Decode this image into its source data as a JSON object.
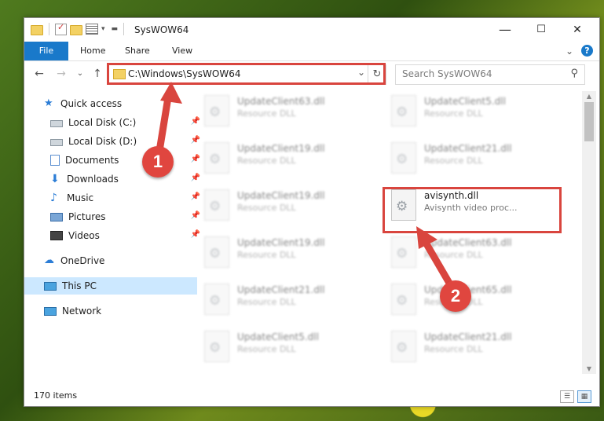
{
  "window": {
    "title": "SysWOW64",
    "controls": {
      "minimize": "—",
      "maximize": "☐",
      "close": "✕"
    }
  },
  "ribbon": {
    "tabs": [
      "File",
      "Home",
      "Share",
      "View"
    ],
    "expand_glyph": "⌄",
    "help_glyph": "?"
  },
  "address_bar": {
    "path": "C:\\Windows\\SysWOW64",
    "dropdown_glyph": "⌄",
    "refresh_glyph": "↻"
  },
  "search": {
    "placeholder": "Search SysWOW64",
    "icon_glyph": "⚲"
  },
  "nav_buttons": {
    "back": "←",
    "forward": "→",
    "recent": "⌄",
    "up": "↑"
  },
  "sidebar": {
    "items": [
      {
        "label": "Quick access",
        "icon": "star-icon"
      },
      {
        "label": "Local Disk (C:)",
        "icon": "drive-icon",
        "pinned": true
      },
      {
        "label": "Local Disk (D:)",
        "icon": "drive-icon",
        "pinned": true
      },
      {
        "label": "Documents",
        "icon": "document-icon",
        "pinned": true
      },
      {
        "label": "Downloads",
        "icon": "download-icon",
        "pinned": true
      },
      {
        "label": "Music",
        "icon": "music-icon",
        "pinned": true
      },
      {
        "label": "Pictures",
        "icon": "picture-icon",
        "pinned": true
      },
      {
        "label": "Videos",
        "icon": "video-icon",
        "pinned": true
      },
      {
        "label": "OneDrive",
        "icon": "cloud-icon"
      },
      {
        "label": "This PC",
        "icon": "computer-icon",
        "selected": true
      },
      {
        "label": "Network",
        "icon": "network-icon"
      }
    ]
  },
  "files": {
    "left_column": [
      {
        "name": "UpdateClient63.dll",
        "desc": "Resource DLL"
      },
      {
        "name": "UpdateClient19.dll",
        "desc": "Resource DLL"
      },
      {
        "name": "UpdateClient19.dll",
        "desc": "Resource DLL"
      },
      {
        "name": "UpdateClient19.dll",
        "desc": "Resource DLL"
      },
      {
        "name": "UpdateClient21.dll",
        "desc": "Resource DLL"
      },
      {
        "name": "UpdateClient5.dll",
        "desc": "Resource DLL"
      }
    ],
    "right_column": [
      {
        "name": "UpdateClient5.dll",
        "desc": "Resource DLL"
      },
      {
        "name": "UpdateClient21.dll",
        "desc": "Resource DLL"
      },
      {
        "name": "avisynth.dll",
        "desc": "Avisynth video proc...",
        "highlighted": true
      },
      {
        "name": "UpdateClient63.dll",
        "desc": "Resource DLL"
      },
      {
        "name": "UpdateClient65.dll",
        "desc": "Resource DLL"
      },
      {
        "name": "UpdateClient21.dll",
        "desc": "Resource DLL"
      }
    ]
  },
  "annotations": {
    "step1": "1",
    "step2": "2",
    "color": "#d9453e"
  },
  "status_bar": {
    "item_count": "170 items"
  }
}
